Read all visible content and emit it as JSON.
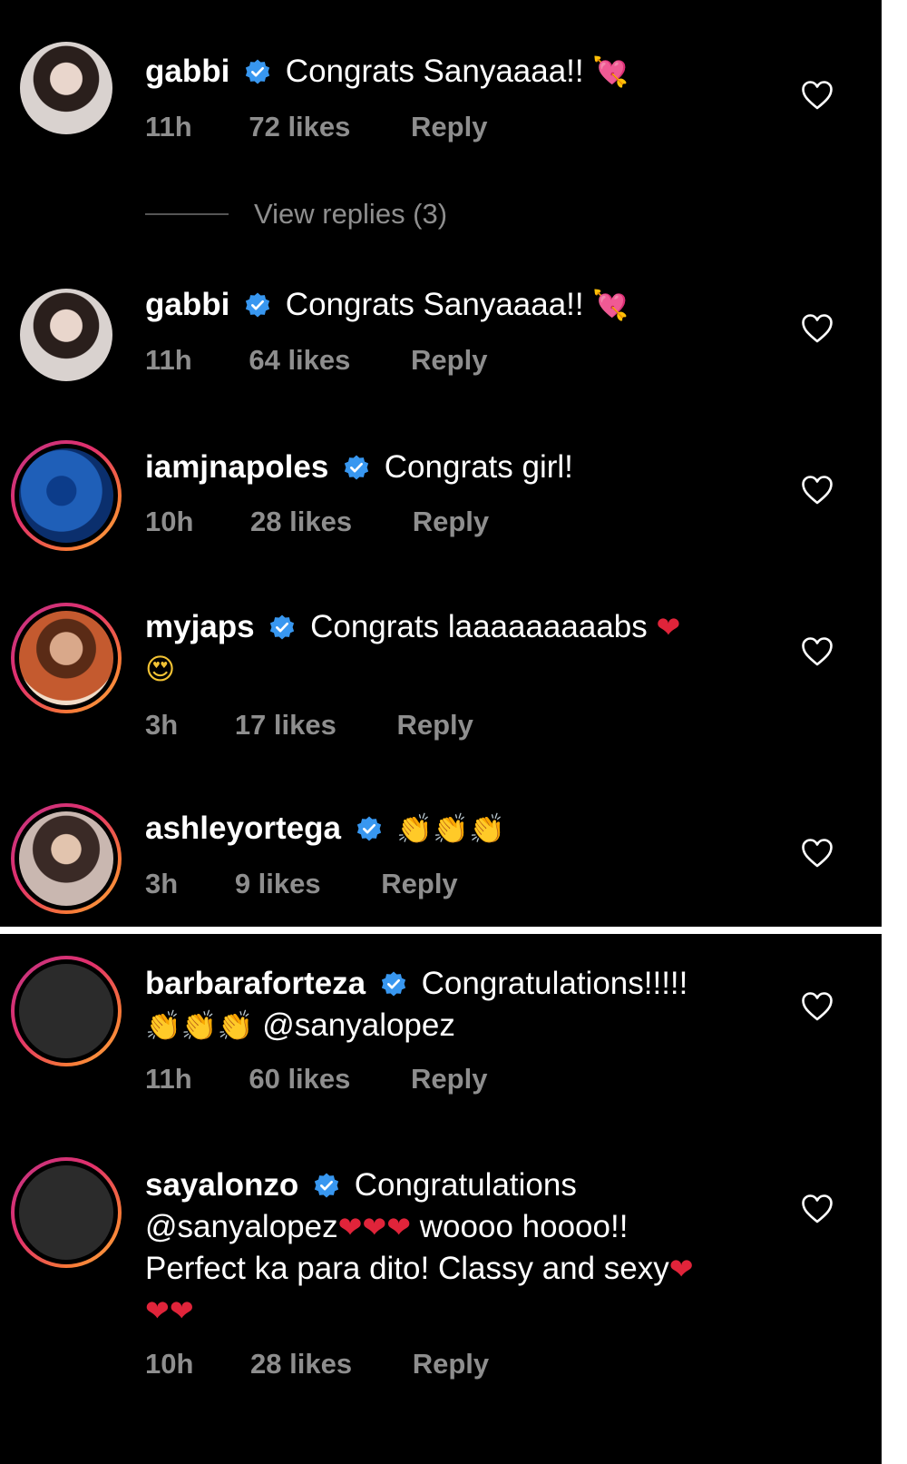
{
  "comments_top": [
    {
      "username": "gabbi",
      "text": "Congrats Sanyaaaa!!",
      "emoji_after": "💘",
      "time": "11h",
      "likes": "72 likes",
      "reply": "Reply",
      "avatar": "photo",
      "view_replies": "View replies (3)"
    },
    {
      "username": "gabbi",
      "text": "Congrats Sanyaaaa!!",
      "emoji_after": "💘",
      "time": "11h",
      "likes": "64 likes",
      "reply": "Reply",
      "avatar": "photo"
    },
    {
      "username": "iamjnapoles",
      "text": "Congrats girl!",
      "time": "10h",
      "likes": "28 likes",
      "reply": "Reply",
      "avatar": "story-ring"
    },
    {
      "username": "myjaps",
      "text": "Congrats laaaaaaaaabs",
      "emoji_after": "❤",
      "emoji_line2": "😍",
      "time": "3h",
      "likes": "17 likes",
      "reply": "Reply",
      "avatar": "story-ring"
    },
    {
      "username": "ashleyortega",
      "emoji_after": "👏👏👏",
      "time": "3h",
      "likes": "9 likes",
      "reply": "Reply",
      "avatar": "story-ring"
    }
  ],
  "comments_bottom": [
    {
      "username": "barbaraforteza",
      "text": "Congratulations!!!!!",
      "line2_emoji": "👏👏👏",
      "line2_text": "@sanyalopez",
      "time": "11h",
      "likes": "60 likes",
      "reply": "Reply",
      "avatar": "story-ring"
    },
    {
      "username": "sayalonzo",
      "text": "Congratulations",
      "line2_text": "@sanyalopez",
      "line2_emoji": "❤❤❤",
      "line2_tail": "woooo hoooo!!",
      "line3_text": "Perfect ka para dito! Classy and sexy",
      "line3_emoji": "❤",
      "line4_emoji": "❤❤",
      "time": "10h",
      "likes": "28 likes",
      "reply": "Reply",
      "avatar": "story-ring"
    }
  ],
  "colors": {
    "background": "#000000",
    "text": "#ffffff",
    "meta": "#8e8e8e",
    "verified": "#3897f0",
    "story_ring": "#e1306c"
  },
  "icons": {
    "verified": "verified-badge-icon",
    "like": "heart-outline-icon"
  }
}
